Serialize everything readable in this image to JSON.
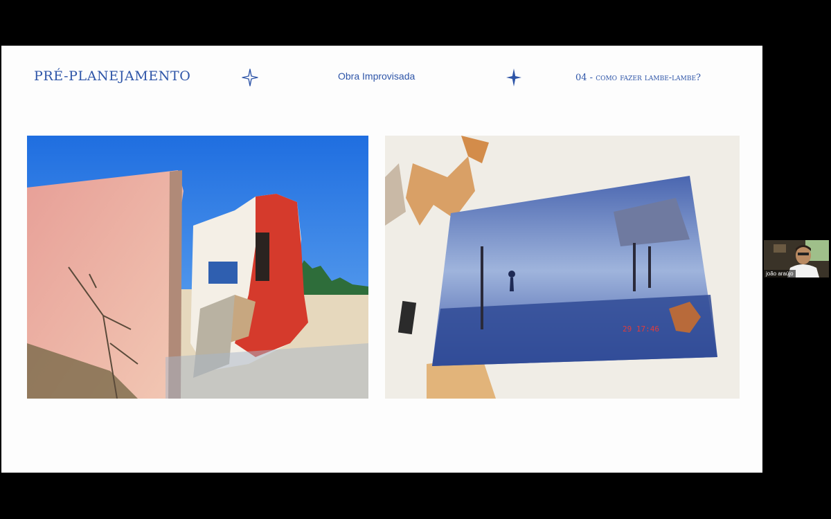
{
  "slide": {
    "title": "PRÉ-PLANEJAMENTO",
    "subtitle": "Obra Improvisada",
    "section": "04 - como fazer lambe-lambe?",
    "icons": [
      "star-outline-icon",
      "star-filled-icon"
    ],
    "accent_color": "#2e55a8",
    "photos": [
      {
        "name": "ruined-wall-photo"
      },
      {
        "name": "lambe-lambe-poster-photo",
        "timestamp": "29 17:46"
      }
    ]
  },
  "webcam": {
    "name": "joão araújo"
  }
}
